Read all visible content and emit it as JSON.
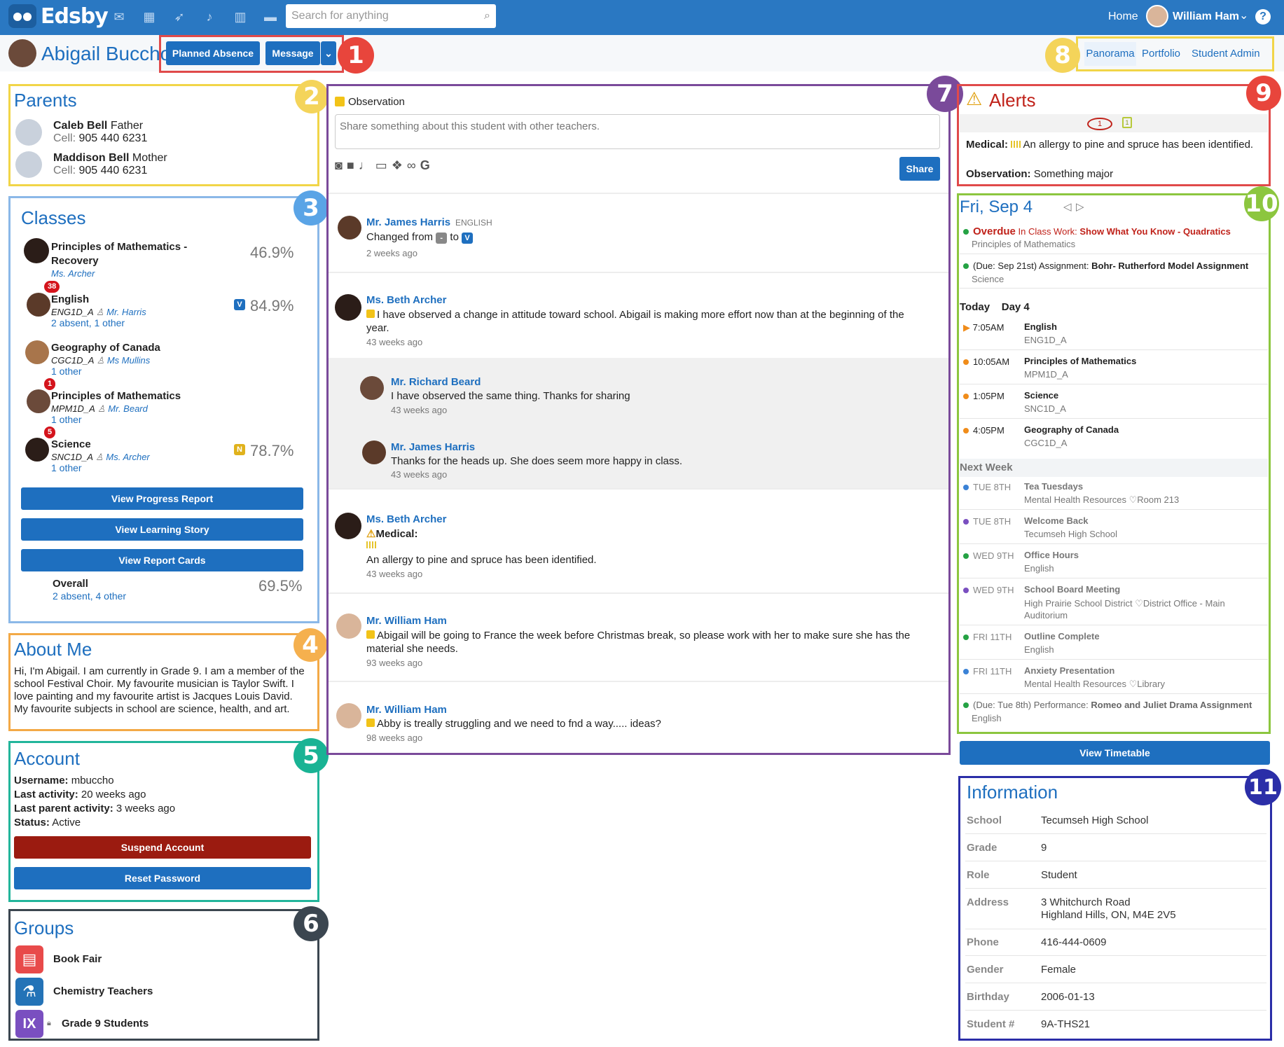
{
  "app": {
    "logo": "Edsby",
    "search_placeholder": "Search for anything",
    "home": "Home",
    "user": "William Ham",
    "help": "?"
  },
  "student": {
    "name": "Abigail Buccho"
  },
  "buttons": {
    "planned_absence": "Planned Absence",
    "message": "Message",
    "caret": "⌄"
  },
  "tabs": [
    "Panorama",
    "Portfolio",
    "Student Admin"
  ],
  "callouts": [
    "1",
    "2",
    "3",
    "4",
    "5",
    "6",
    "7",
    "8",
    "9",
    "10",
    "11"
  ],
  "parents": {
    "title": "Parents",
    "items": [
      {
        "name": "Caleb Bell",
        "relation": "Father",
        "cell_label": "Cell:",
        "cell": "905 440 6231"
      },
      {
        "name": "Maddison Bell",
        "relation": "Mother",
        "cell_label": "Cell:",
        "cell": "905 440 6231"
      }
    ]
  },
  "classes": {
    "title": "Classes",
    "items": [
      {
        "name": "Principles of Mathematics - Recovery",
        "teacher": "Ms. Archer",
        "grade": "46.9%"
      },
      {
        "name": "English",
        "code": "ENG1D_A",
        "teacher": "Mr. Harris",
        "extra": "2 absent, 1 other",
        "grade": "84.9%",
        "badge": "38",
        "mark": "V"
      },
      {
        "name": "Geography of Canada",
        "code": "CGC1D_A",
        "teacher": "Ms Mullins",
        "extra": "1 other"
      },
      {
        "name": "Principles of Mathematics",
        "code": "MPM1D_A",
        "teacher": "Mr. Beard",
        "extra": "1 other",
        "badge": "1"
      },
      {
        "name": "Science",
        "code": "SNC1D_A",
        "teacher": "Ms. Archer",
        "extra": "1 other",
        "grade": "78.7%",
        "badge": "5",
        "mark": "N"
      }
    ],
    "buttons": [
      "View Progress Report",
      "View Learning Story",
      "View Report Cards"
    ],
    "overall": {
      "label": "Overall",
      "extra": "2 absent, 4 other",
      "grade": "69.5%"
    }
  },
  "about": {
    "title": "About Me",
    "text": "Hi, I'm Abigail. I am currently in Grade 9. I am a member of the school Festival Choir. My favourite musician is Taylor Swift. I love painting and my favourite artist is Jacques Louis David. My favourite subjects in school are science, health, and art."
  },
  "account": {
    "title": "Account",
    "username_label": "Username:",
    "username": "mbuccho",
    "last_activity_label": "Last activity:",
    "last_activity": "20 weeks ago",
    "last_parent_label": "Last parent activity:",
    "last_parent": "3 weeks ago",
    "status_label": "Status:",
    "status": "Active",
    "suspend": "Suspend Account",
    "reset": "Reset Password"
  },
  "groups": {
    "title": "Groups",
    "items": [
      "Book Fair",
      "Chemistry Teachers",
      "Grade 9 Students"
    ]
  },
  "feed": {
    "observation_label": "Observation",
    "placeholder": "Share something about this student with other teachers.",
    "share": "Share",
    "posts": [
      {
        "author": "Mr. James Harris",
        "tag": "ENGLISH",
        "text_a": "Changed from",
        "from": "-",
        "to_word": "to",
        "to": "V",
        "time": "2 weeks ago"
      },
      {
        "author": "Ms. Beth Archer",
        "text": "I have observed a change in attitude toward school. Abigail is making more effort now than at the beginning of the year.",
        "time": "43 weeks ago"
      },
      {
        "author": "Mr. Richard Beard",
        "text": "I have observed the same thing. Thanks for sharing",
        "time": "43 weeks ago"
      },
      {
        "author": "Mr. James Harris",
        "text": "Thanks for the heads up. She does seem more happy in class.",
        "time": "43 weeks ago"
      },
      {
        "author": "Ms. Beth Archer",
        "label": "Medical:",
        "text": "An allergy to pine and spruce has been identified.",
        "time": "43 weeks ago"
      },
      {
        "author": "Mr. William Ham",
        "text": "Abigail will be going to France the week before Christmas break, so please work with her to make sure she has the material she needs.",
        "time": "93 weeks ago"
      },
      {
        "author": "Mr. William Ham",
        "text": "Abby is treally struggling and we need to fnd a way..... ideas?",
        "time": "98 weeks ago"
      }
    ]
  },
  "alerts": {
    "title": "Alerts",
    "count": "1",
    "cal_num": "1",
    "medical_label": "Medical:",
    "medical": "An allergy to pine and spruce has been identified.",
    "obs_label": "Observation:",
    "obs": "Something major"
  },
  "schedule": {
    "date": "Fri, Sep 4",
    "overdue": {
      "label": "Overdue",
      "type": "In Class Work:",
      "title": "Show What You Know - Quadratics",
      "course": "Principles of Mathematics"
    },
    "due": {
      "when": "(Due: Sep 21st)",
      "type": "Assignment:",
      "title": "Bohr- Rutherford Model Assignment",
      "course": "Science"
    },
    "today_label": "Today",
    "day_label": "Day 4",
    "today": [
      {
        "time": "7:05AM",
        "title": "English",
        "sub": "ENG1D_A"
      },
      {
        "time": "10:05AM",
        "title": "Principles of Mathematics",
        "sub": "MPM1D_A"
      },
      {
        "time": "1:05PM",
        "title": "Science",
        "sub": "SNC1D_A"
      },
      {
        "time": "4:05PM",
        "title": "Geography of Canada",
        "sub": "CGC1D_A"
      }
    ],
    "next_label": "Next Week",
    "next": [
      {
        "day": "TUE 8TH",
        "title": "Tea Tuesdays",
        "sub": "Mental Health Resources",
        "loc": "Room 213",
        "color": "#3b82d6"
      },
      {
        "day": "TUE 8TH",
        "title": "Welcome Back",
        "sub": "Tecumseh High School",
        "color": "#7a4fc0"
      },
      {
        "day": "WED 9TH",
        "title": "Office Hours",
        "sub": "English",
        "color": "#25a244"
      },
      {
        "day": "WED 9TH",
        "title": "School Board Meeting",
        "sub": "High Prairie School District",
        "loc": "District Office - Main Auditorium",
        "color": "#7a4fc0"
      },
      {
        "day": "FRI 11TH",
        "title": "Outline Complete",
        "sub": "English",
        "color": "#25a244"
      },
      {
        "day": "FRI 11TH",
        "title": "Anxiety Presentation",
        "sub": "Mental Health Resources",
        "loc": "Library",
        "color": "#3b82d6"
      }
    ],
    "last": {
      "when": "(Due: Tue 8th)",
      "type": "Performance:",
      "title": "Romeo and Juliet Drama Assignment",
      "course": "English"
    },
    "view_timetable": "View Timetable"
  },
  "information": {
    "title": "Information",
    "rows": [
      {
        "label": "School",
        "value": "Tecumseh High School"
      },
      {
        "label": "Grade",
        "value": "9"
      },
      {
        "label": "Role",
        "value": "Student"
      },
      {
        "label": "Address",
        "value": "3 Whitchurch Road",
        "value2": "Highland Hills, ON, M4E 2V5"
      },
      {
        "label": "Phone",
        "value": "416-444-0609"
      },
      {
        "label": "Gender",
        "value": "Female"
      },
      {
        "label": "Birthday",
        "value": "2006-01-13"
      },
      {
        "label": "Student #",
        "value": "9A-THS21"
      }
    ]
  },
  "colors": {
    "brand": "#2a78c2",
    "link": "#1e6fbf",
    "danger": "#9b1b10"
  }
}
